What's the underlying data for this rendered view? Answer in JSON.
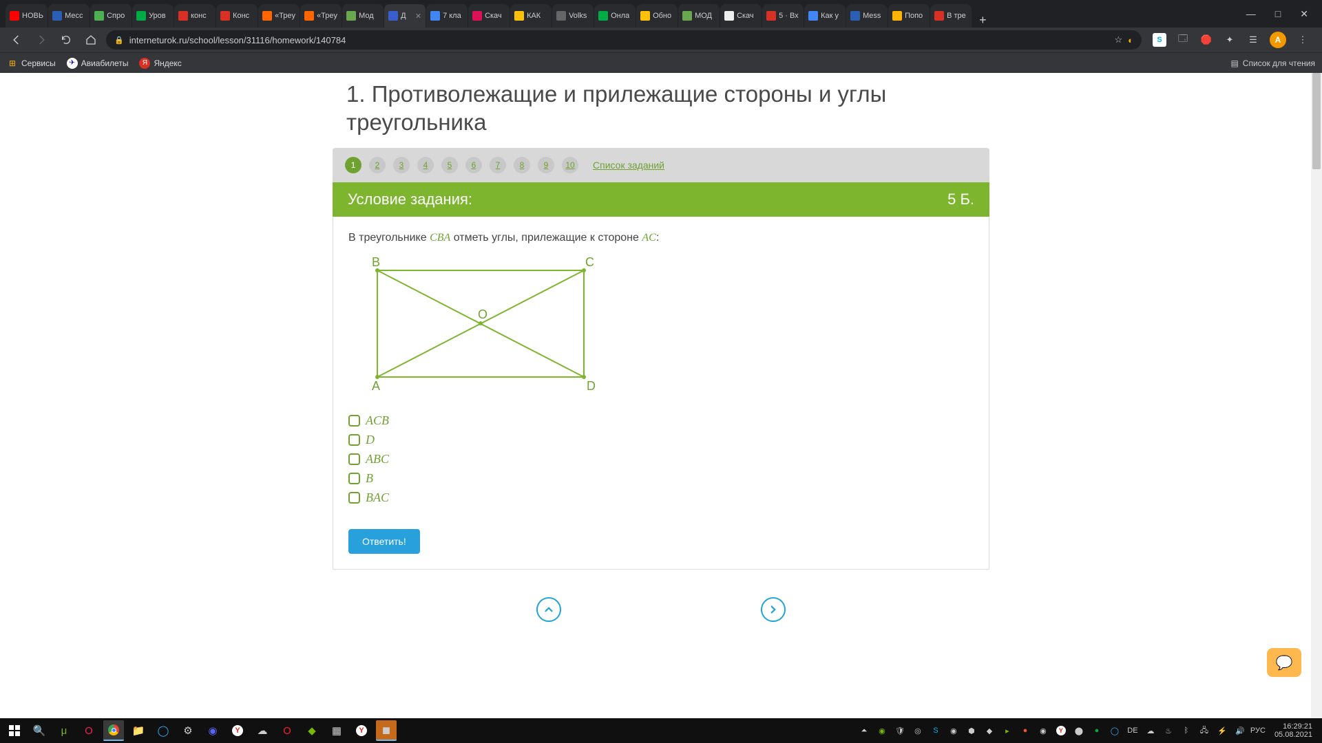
{
  "window": {
    "minimize": "—",
    "maximize": "□",
    "close": "✕"
  },
  "tabs": [
    {
      "title": "НОВЬ",
      "color": "#ff0000"
    },
    {
      "title": "Месс",
      "color": "#2b5fb3"
    },
    {
      "title": "Спро",
      "color": "#4caf50"
    },
    {
      "title": "Уров",
      "color": "#0a4"
    },
    {
      "title": "конс",
      "color": "#d93025"
    },
    {
      "title": "Конс",
      "color": "#d93025"
    },
    {
      "title": "«Трeу",
      "color": "#ff6600"
    },
    {
      "title": "«Трeу",
      "color": "#ff6600"
    },
    {
      "title": "Мод",
      "color": "#6aa84f"
    },
    {
      "title": "Д",
      "color": "#3a5fcd",
      "active": true
    },
    {
      "title": "7 кла",
      "color": "#4285f4"
    },
    {
      "title": "Скач",
      "color": "#d15"
    },
    {
      "title": "КАК",
      "color": "#ffc107"
    },
    {
      "title": "Volks",
      "color": "#666"
    },
    {
      "title": "Онла",
      "color": "#0a4"
    },
    {
      "title": "Обно",
      "color": "#ffc107"
    },
    {
      "title": "МОД",
      "color": "#6aa84f"
    },
    {
      "title": "Скач",
      "color": "#eee"
    },
    {
      "title": "5 · Вх",
      "color": "#d93025"
    },
    {
      "title": "Как у",
      "color": "#4285f4"
    },
    {
      "title": "Mess",
      "color": "#2b5fb3"
    },
    {
      "title": "Попо",
      "color": "#ffb300"
    },
    {
      "title": "В тре",
      "color": "#d93025"
    }
  ],
  "url": "interneturok.ru/school/lesson/31116/homework/140784",
  "bookmarks": {
    "apps": "Сервисы",
    "b1": "Авиабилеты",
    "b2": "Яндекс",
    "reading": "Список для чтения"
  },
  "avatar": "А",
  "page": {
    "title": "1. Противолежащие и прилежащие стороны и углы треугольника",
    "nav": [
      "1",
      "2",
      "3",
      "4",
      "5",
      "6",
      "7",
      "8",
      "9",
      "10"
    ],
    "list_link": "Список заданий",
    "condition_label": "Условие задания:",
    "points": "5 Б.",
    "text_before": "В треугольнике ",
    "triangle": "CBA",
    "text_mid": " отметь углы, прилежащие к стороне ",
    "side": "AC",
    "text_after": ":",
    "answers": [
      "ACB",
      "D",
      "ABC",
      "B",
      "BAC"
    ],
    "submit": "Ответить!"
  },
  "figure": {
    "B": "B",
    "C": "C",
    "A": "A",
    "D": "D",
    "O": "O"
  },
  "taskbar": {
    "lang": "РУС",
    "time": "16:29:21",
    "date": "05.08.2021"
  }
}
